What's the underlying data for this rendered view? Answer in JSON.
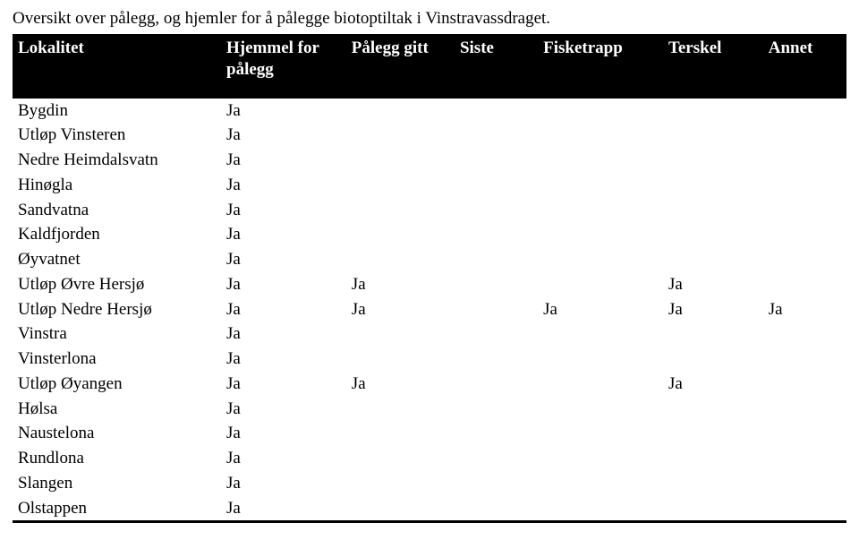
{
  "caption": "Oversikt over pålegg, og hjemler for å pålegge biotoptiltak i Vinstravassdraget.",
  "headers": {
    "lokalitet": "Lokalitet",
    "hjemmel": "Hjemmel for pålegg",
    "palegg": "Pålegg gitt",
    "siste": "Siste",
    "fisketrapp": "Fisketrapp",
    "terskel": "Terskel",
    "annet": "Annet"
  },
  "rows": [
    {
      "lokalitet": "Bygdin",
      "hjemmel": "Ja",
      "palegg": "",
      "siste": "",
      "fisketrapp": "",
      "terskel": "",
      "annet": ""
    },
    {
      "lokalitet": "Utløp Vinsteren",
      "hjemmel": "Ja",
      "palegg": "",
      "siste": "",
      "fisketrapp": "",
      "terskel": "",
      "annet": ""
    },
    {
      "lokalitet": "Nedre Heimdalsvatn",
      "hjemmel": "Ja",
      "palegg": "",
      "siste": "",
      "fisketrapp": "",
      "terskel": "",
      "annet": ""
    },
    {
      "lokalitet": "Hinøgla",
      "hjemmel": "Ja",
      "palegg": "",
      "siste": "",
      "fisketrapp": "",
      "terskel": "",
      "annet": ""
    },
    {
      "lokalitet": "Sandvatna",
      "hjemmel": "Ja",
      "palegg": "",
      "siste": "",
      "fisketrapp": "",
      "terskel": "",
      "annet": ""
    },
    {
      "lokalitet": "Kaldfjorden",
      "hjemmel": "Ja",
      "palegg": "",
      "siste": "",
      "fisketrapp": "",
      "terskel": "",
      "annet": ""
    },
    {
      "lokalitet": "Øyvatnet",
      "hjemmel": "Ja",
      "palegg": "",
      "siste": "",
      "fisketrapp": "",
      "terskel": "",
      "annet": ""
    },
    {
      "lokalitet": "Utløp Øvre Hersjø",
      "hjemmel": "Ja",
      "palegg": "Ja",
      "siste": "",
      "fisketrapp": "",
      "terskel": "Ja",
      "annet": ""
    },
    {
      "lokalitet": "Utløp Nedre Hersjø",
      "hjemmel": "Ja",
      "palegg": "Ja",
      "siste": "",
      "fisketrapp": "Ja",
      "terskel": "Ja",
      "annet": "Ja"
    },
    {
      "lokalitet": "Vinstra",
      "hjemmel": "Ja",
      "palegg": "",
      "siste": "",
      "fisketrapp": "",
      "terskel": "",
      "annet": ""
    },
    {
      "lokalitet": "Vinsterlona",
      "hjemmel": "Ja",
      "palegg": "",
      "siste": "",
      "fisketrapp": "",
      "terskel": "",
      "annet": ""
    },
    {
      "lokalitet": "Utløp Øyangen",
      "hjemmel": "Ja",
      "palegg": "Ja",
      "siste": "",
      "fisketrapp": "",
      "terskel": "Ja",
      "annet": ""
    },
    {
      "lokalitet": "Hølsa",
      "hjemmel": "Ja",
      "palegg": "",
      "siste": "",
      "fisketrapp": "",
      "terskel": "",
      "annet": ""
    },
    {
      "lokalitet": "Naustelona",
      "hjemmel": "Ja",
      "palegg": "",
      "siste": "",
      "fisketrapp": "",
      "terskel": "",
      "annet": ""
    },
    {
      "lokalitet": "Rundlona",
      "hjemmel": "Ja",
      "palegg": "",
      "siste": "",
      "fisketrapp": "",
      "terskel": "",
      "annet": ""
    },
    {
      "lokalitet": "Slangen",
      "hjemmel": "Ja",
      "palegg": "",
      "siste": "",
      "fisketrapp": "",
      "terskel": "",
      "annet": ""
    },
    {
      "lokalitet": "Olstappen",
      "hjemmel": "Ja",
      "palegg": "",
      "siste": "",
      "fisketrapp": "",
      "terskel": "",
      "annet": ""
    }
  ]
}
